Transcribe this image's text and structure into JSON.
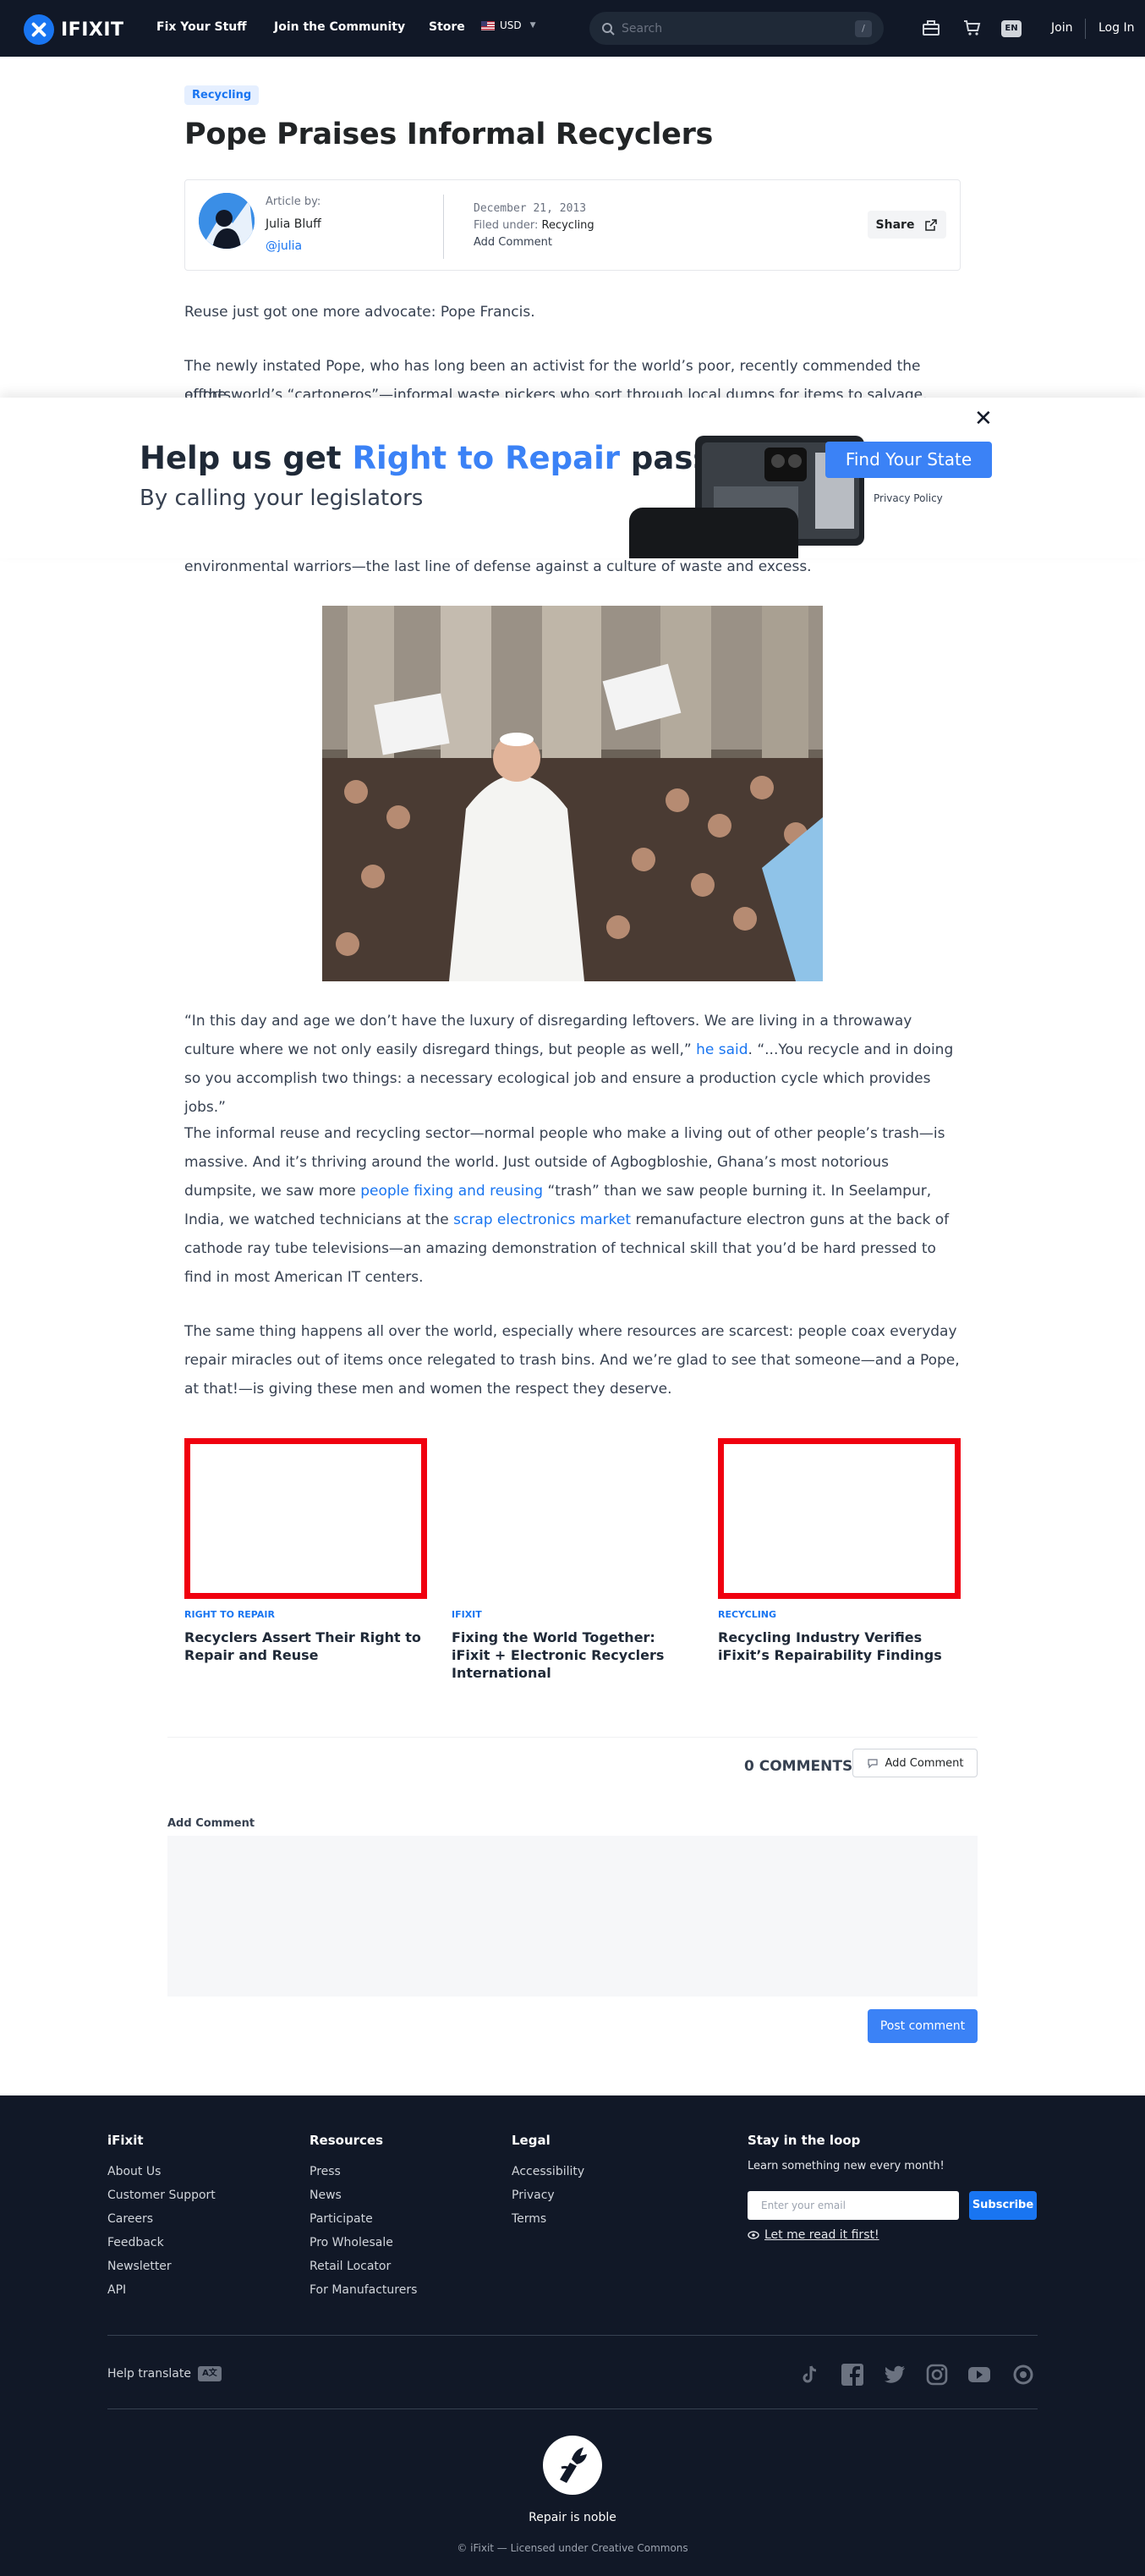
{
  "nav": {
    "logo_text": "IFIXIT",
    "links": [
      "Fix Your Stuff",
      "Join the Community",
      "Store"
    ],
    "currency": "USD",
    "search_placeholder": "Search",
    "search_shortcut": "/",
    "language": "EN",
    "join": "Join",
    "login": "Log In"
  },
  "article": {
    "tag": "Recycling",
    "title": "Pope Praises Informal Recyclers",
    "author_label": "Article by:",
    "author_name": "Julia Bluff",
    "author_handle": "@julia",
    "date": "December 21, 2013",
    "filed_label": "Filed under:",
    "filed_value": "Recycling",
    "add_comment": "Add Comment",
    "share": "Share",
    "p1": "Reuse just got one more advocate: Pope Francis.",
    "p2a": "The newly instated Pope, who has long been an activist for the world’s poor, recently commended the efforts",
    "p2b": "of the world’s “cartoneros”—informal waste pickers who sort through local dumps for items to salvage.",
    "p3": "environmental warriors—the last line of defense against a culture of waste and excess.",
    "p4_before": "“In this day and age we don’t have the luxury of disregarding leftovers. We are living in a throwaway culture where we not only easily disregard things, but people as well,” ",
    "p4_link": "he said",
    "p4_after": ". “...You recycle and in doing so you accomplish two things: a necessary ecological job and ensure a production cycle which provides jobs.”",
    "p5_a": "The informal reuse and recycling sector—normal people who make a living out of other people’s trash—is massive. And it’s thriving around the world. Just outside of Agbogbloshie, Ghana’s most notorious dumpsite, we saw more ",
    "p5_link1": "people fixing and reusing",
    "p5_b": " “trash” than we saw people burning it. In Seelampur, India, we watched technicians at the ",
    "p5_link2": "scrap electronics market",
    "p5_c": " remanufacture electron guns at the back of cathode ray tube televisions—an amazing demonstration of technical skill that you’d be hard pressed to find in most American IT centers.",
    "p6": "The same thing happens all over the world, especially where resources are scarcest: people coax everyday repair miracles out of items once relegated to trash bins. And we’re glad to see that someone—and a Pope, at that!—is giving these men and women the respect they deserve."
  },
  "banner": {
    "heading_a": "Help us get ",
    "heading_b": "Right to Repair",
    "heading_c": " passed",
    "subheading": "By calling your legislators",
    "button": "Find Your State",
    "privacy": "Privacy Policy"
  },
  "related": [
    {
      "category": "Right to Repair",
      "title": "Recyclers Assert Their Right to Repair and Reuse"
    },
    {
      "category": "iFixit",
      "title": "Fixing the World Together: iFixit + Electronic Recyclers International"
    },
    {
      "category": "Recycling",
      "title": "Recycling Industry Verifies iFixit’s Repairability Findings"
    }
  ],
  "comments": {
    "count": "0 COMMENTS",
    "add_button": "Add Comment",
    "add_label": "Add Comment",
    "post_button": "Post comment"
  },
  "footer": {
    "col1": {
      "title": "iFixit",
      "links": [
        "About Us",
        "Customer Support",
        "Careers",
        "Feedback",
        "Newsletter",
        "API"
      ]
    },
    "col2": {
      "title": "Resources",
      "links": [
        "Press",
        "News",
        "Participate",
        "Pro Wholesale",
        "Retail Locator",
        "For Manufacturers"
      ]
    },
    "col3": {
      "title": "Legal",
      "links": [
        "Accessibility",
        "Privacy",
        "Terms"
      ]
    },
    "loop": {
      "title": "Stay in the loop",
      "subtitle": "Learn something new every month!",
      "email_placeholder": "Enter your email",
      "subscribe": "Subscribe",
      "read_first": "Let me read it first!"
    },
    "help_translate": "Help translate",
    "tagline": "Repair is noble",
    "copyright": "© iFixit — Licensed under Creative Commons"
  },
  "colors": {
    "brand_blue": "#1975f1",
    "banner_blue": "#3b82f6",
    "dark_bg": "#111827",
    "related_border": "#f0000f"
  }
}
